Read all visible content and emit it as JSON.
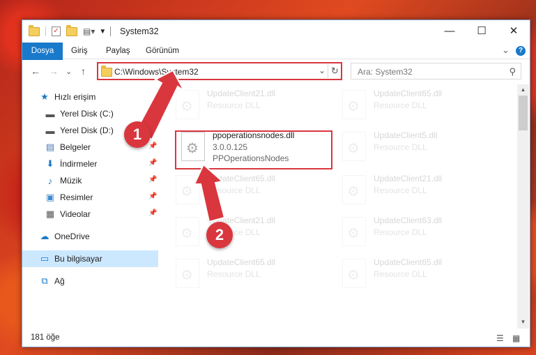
{
  "window": {
    "title": "System32",
    "minimize": "—",
    "maximize": "☐",
    "close": "✕"
  },
  "ribbon": {
    "tabs": [
      "Dosya",
      "Giriş",
      "Paylaş",
      "Görünüm"
    ],
    "collapse_icon": "⌄",
    "help": "?"
  },
  "nav": {
    "back": "←",
    "forward": "→",
    "recent": "⌄",
    "up": "↑",
    "address": "C:\\Windows\\System32",
    "address_dropdown": "⌄",
    "refresh": "↻",
    "search_placeholder": "Ara: System32",
    "search_icon": "⚲"
  },
  "sidebar": {
    "items": [
      {
        "label": "Hızlı erişim",
        "icon": "star-icon",
        "glyph": "★",
        "color": "#1979ca"
      },
      {
        "label": "Yerel Disk (C:)",
        "icon": "drive-icon",
        "glyph": "▬",
        "color": "#555555",
        "pin": "📌"
      },
      {
        "label": "Yerel Disk (D:)",
        "icon": "drive-icon",
        "glyph": "▬",
        "color": "#555555",
        "pin": "📌"
      },
      {
        "label": "Belgeler",
        "icon": "documents-icon",
        "glyph": "▤",
        "color": "#4a78b5",
        "pin": "📌"
      },
      {
        "label": "İndirmeler",
        "icon": "downloads-icon",
        "glyph": "⬇",
        "color": "#1979ca",
        "pin": "📌"
      },
      {
        "label": "Müzik",
        "icon": "music-icon",
        "glyph": "♪",
        "color": "#1979ca",
        "pin": "📌"
      },
      {
        "label": "Resimler",
        "icon": "pictures-icon",
        "glyph": "▣",
        "color": "#3a8bd0",
        "pin": "📌"
      },
      {
        "label": "Videolar",
        "icon": "videos-icon",
        "glyph": "▦",
        "color": "#555555",
        "pin": "📌"
      },
      {
        "label": "OneDrive",
        "icon": "onedrive-icon",
        "glyph": "☁",
        "color": "#1979ca"
      },
      {
        "label": "Bu bilgisayar",
        "icon": "computer-icon",
        "glyph": "▭",
        "color": "#1979ca"
      },
      {
        "label": "Ağ",
        "icon": "network-icon",
        "glyph": "⧉",
        "color": "#1979ca"
      }
    ]
  },
  "files": [
    {
      "name": "UpdateClient21.dll",
      "desc": "Resource DLL"
    },
    {
      "name": "UpdateClient65.dll",
      "desc": "Resource DLL"
    },
    {
      "name": "ppoperationsnodes.dll",
      "version": "3.0.0.125",
      "desc": "PPOperationsNodes"
    },
    {
      "name": "UpdateClient5.dll",
      "desc": "Resource DLL"
    },
    {
      "name": "UpdateClient65.dll",
      "desc": "Resource DLL"
    },
    {
      "name": "UpdateClient21.dll",
      "desc": "Resource DLL"
    },
    {
      "name": "UpdateClient21.dll",
      "desc": "Resource DLL"
    },
    {
      "name": "UpdateClient63.dll",
      "desc": "Resource DLL"
    },
    {
      "name": "UpdateClient65.dll",
      "desc": "Resource DLL"
    },
    {
      "name": "UpdateClient65.dll",
      "desc": "Resource DLL"
    }
  ],
  "status": {
    "count": "181 öğe",
    "details_view": "☰",
    "tiles_view": "▦"
  },
  "annotations": {
    "step1": "1",
    "step2": "2",
    "color": "#d9363e"
  }
}
